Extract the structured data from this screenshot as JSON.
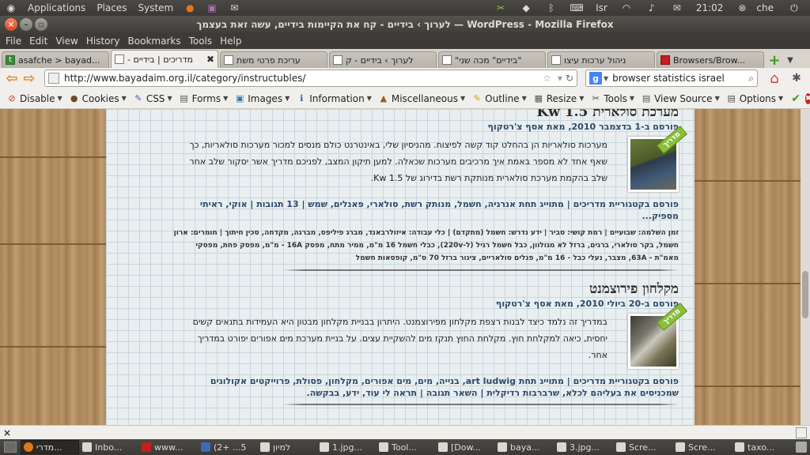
{
  "panel": {
    "applications": "Applications",
    "places": "Places",
    "system": "System",
    "keyboard": "Isr",
    "time": "21:02",
    "user": "che"
  },
  "window": {
    "title": "לערוך › בידיים - קח את הקיימות בידיים, עשה זאת בעצמך — WordPress - Mozilla Firefox"
  },
  "menubar": [
    "File",
    "Edit",
    "View",
    "History",
    "Bookmarks",
    "Tools",
    "Help"
  ],
  "tabs": [
    {
      "label": "asafche > bayad...",
      "icon": "green",
      "active": false
    },
    {
      "label": "- מדריכים | בידיים",
      "icon": "page",
      "active": true
    },
    {
      "label": "עריכת פרטי משת",
      "icon": "page",
      "active": false
    },
    {
      "label": "לערוך › בידיים - ק",
      "icon": "page",
      "active": false
    },
    {
      "label": "\"בידיים\" מכה שני\"",
      "icon": "page",
      "active": false
    },
    {
      "label": "ניהול ערכות עיצו",
      "icon": "page",
      "active": false
    },
    {
      "label": "Browsers/Brow...",
      "icon": "red",
      "active": false
    }
  ],
  "navbar": {
    "url": "http://www.bayadaim.org.il/category/instructubles/",
    "search_engine": "g",
    "search_query": "browser statistics israel"
  },
  "devbar": {
    "items": [
      {
        "label": "Disable",
        "icon": "⊘",
        "color": "#c43a2a"
      },
      {
        "label": "Cookies",
        "icon": "●",
        "color": "#6a4a2a"
      },
      {
        "label": "CSS",
        "icon": "✎",
        "color": "#3a6aaa"
      },
      {
        "label": "Forms",
        "icon": "▤",
        "color": "#555555"
      },
      {
        "label": "Images",
        "icon": "▣",
        "color": "#3a7aaa"
      },
      {
        "label": "Information",
        "icon": "ℹ",
        "color": "#2a5ab0"
      },
      {
        "label": "Miscellaneous",
        "icon": "▲",
        "color": "#a05a2a"
      },
      {
        "label": "Outline",
        "icon": "✎",
        "color": "#c89a20"
      },
      {
        "label": "Resize",
        "icon": "▦",
        "color": "#555555"
      },
      {
        "label": "Tools",
        "icon": "✂",
        "color": "#444444"
      },
      {
        "label": "View Source",
        "icon": "▤",
        "color": "#555555"
      },
      {
        "label": "Options",
        "icon": "▤",
        "color": "#555555"
      }
    ]
  },
  "posts": [
    {
      "title": "מערכת סולארית 1.5 Kw",
      "meta": "פורסם ב-1 בדצמבר 2010, מאת אסף צ'רטקוף",
      "badge": "מדריך",
      "excerpt": "מערכות סולאריות הן בהחלט קוד קשה לפיצוח. מהניסיון שלי, באינטרנט כולם מנסים למכור מערכות סולאריות, כך שאף אחד לא מספר באמת איך מרכיבים מערכות שכאלה. למען תיקון המצב, לפניכם מדריך אשר יסקור שלב אחר שלב בהקמת מערכת סולארית מנותקת רשת בדירוג של Kw 1.5.",
      "tags": "פורסם בקטגוריית מדריכים | מתוייג תחת אנרגיה, חשמל, מנותק רשת, סולארי, פאנלים, שמש | 13 תגובות | אוקי, ראיתי מספיק...",
      "extra": "זמן השלמה: שבועיים | רמת קושי: סביר | ידע נדרש: חשמל (מתקדם) | כלי עבודה: איזולרבאנד, מברג פיליפס, מברגה, מקדחה, סכין חיתוך | חומרים: ארון חשמל, בקר סולארי, ברגים, ברזל לא מגולוון, כבל חשמל רגיל (ל-220v), כבלי חשמל 16 מ\"מ, ממיר מתח, מפסק 16A - מ\"מ, מפסק פחת, מפסקי מאמ\"ת - 63A, מצבר, נעלי כבל - 16 מ\"מ, פנלים סולאריים, צינור ברזל 70 ס\"מ, קופסאות חשמל"
    },
    {
      "title": "מקלחון פירוצמנט",
      "meta": "פורסם ב-20 ביולי 2010, מאת אסף צ'רטקוף",
      "badge": "מדריך",
      "excerpt": "במדריך זה נלמד כיצד לבנות רצפת מקלחון מפירוצמנט. היתרון בבניית מקלחון מבטון היא העמידות בתנאים קשים יחסית, כיאה למקלחת חוץ. מקלחת החוץ תנקז מים להשקיית עצים. על בניית מערכת מים אפורים יפורט במדריך אחר.",
      "tags": "פורסם בקטגוריית מדריכים | מתוייג תחת art ludwig, בנייה, מים, מים אפורים, מקלחון, פסולת, פרוייקטים אקולוגים שמכניסים את בעליהם לכלא, שרברבות רדיקלית | השאר תגובה | תראה לי עוד, ידע, בבקשה."
    }
  ],
  "taskbar": [
    {
      "label": "מדרי...",
      "icon": "ff",
      "active": true
    },
    {
      "label": "Inbo...",
      "icon": "mail"
    },
    {
      "label": "www...",
      "icon": "red"
    },
    {
      "label": "(2+ ...5",
      "icon": "blue"
    },
    {
      "label": "למיון",
      "icon": "folder"
    },
    {
      "label": "1.jpg...",
      "icon": "img"
    },
    {
      "label": "Tool...",
      "icon": "tool"
    },
    {
      "label": "[Dow...",
      "icon": "folder"
    },
    {
      "label": "baya...",
      "icon": "folder"
    },
    {
      "label": "3.jpg...",
      "icon": "img"
    },
    {
      "label": "Scre...",
      "icon": "img"
    },
    {
      "label": "Scre...",
      "icon": "img"
    },
    {
      "label": "taxo...",
      "icon": "folder"
    }
  ]
}
